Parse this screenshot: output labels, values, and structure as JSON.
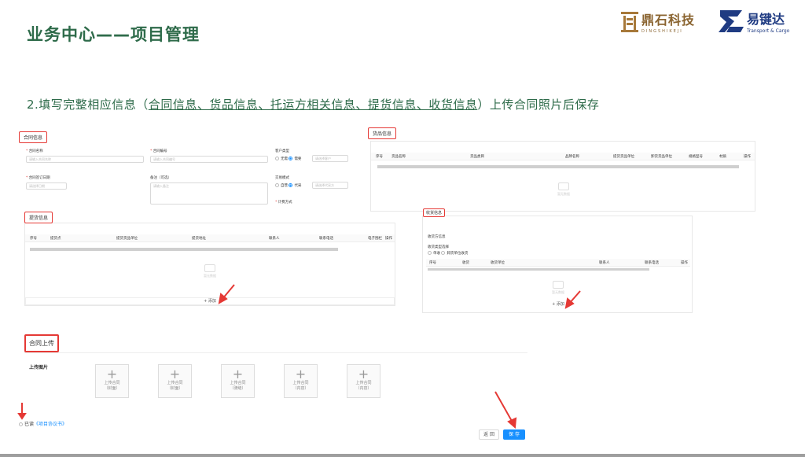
{
  "slide": {
    "title": "业务中心——项目管理",
    "subtitle_prefix": "2.填写完整相应信息（",
    "subtitle_underlined": "合同信息、货品信息、托运方相关信息、提货信息、收货信息",
    "subtitle_suffix": "）上传合同照片后保存"
  },
  "logos": {
    "dingshi_cn": "鼎石科技",
    "dingshi_en": "DINGSHIKEJI",
    "yijianda_cn": "易键达",
    "yijianda_en": "Transport & Cargo"
  },
  "contract_panel": {
    "tag": "合同信息",
    "name_label": "合同名称",
    "name_placeholder": "请输入合同名称",
    "number_label": "合同编号",
    "number_placeholder": "请输入合同编号",
    "customer_type_label": "客户类型",
    "customer_opt1": "无需",
    "customer_opt2": "需要",
    "customer_select": "请选择客户",
    "sign_date_label": "合同签订日期",
    "sign_date_placeholder": "请选择日期",
    "remark_label": "备注（可选）",
    "remark_placeholder": "请输入备注",
    "trade_mode_label": "交易模式",
    "trade_opt1": "自营",
    "trade_opt2": "代采",
    "trade_select": "请选择代采方",
    "billing_label": "计费方式"
  },
  "goods_panel": {
    "tag": "货品信息",
    "columns": [
      "序号",
      "货品名称",
      "货品类目",
      "品牌名称",
      "提货货品单位",
      "卸货货品单位",
      "规格型号",
      "材质",
      "操作"
    ],
    "empty_text": "暂无数据"
  },
  "pickup_panel": {
    "tag": "提货信息",
    "columns": [
      "序号",
      "提货点",
      "提货货品单位",
      "提货地址",
      "联系人",
      "联系电话",
      "电子围栏",
      "操作"
    ],
    "empty_text": "暂无数据",
    "add_label": "添加"
  },
  "receive_panel": {
    "tag": "收货信息",
    "section_label": "收货方信息",
    "sub_label": "收货类型选择",
    "opt1": "单收",
    "opt2": "卸货单位收货",
    "columns": [
      "序号",
      "收货",
      "收货单位",
      "联系人",
      "联系电话",
      "操作"
    ],
    "empty_text": "暂无数据",
    "add_label": "添加"
  },
  "upload_section": {
    "tag": "合同上传",
    "label": "上传图片",
    "slots": [
      {
        "line1": "上传合同",
        "line2": "（封面）"
      },
      {
        "line1": "上传合同",
        "line2": "（封面）"
      },
      {
        "line1": "上传合同",
        "line2": "（骑缝）"
      },
      {
        "line1": "上传合同",
        "line2": "（内容）"
      },
      {
        "line1": "上传合同",
        "line2": "（内容）"
      }
    ]
  },
  "agreement": {
    "prefix": "已读",
    "link": "《项目协议书》"
  },
  "buttons": {
    "back": "返 回",
    "save": "保 存"
  },
  "colors": {
    "title_green": "#2e6b4a",
    "highlight_red": "#e53935",
    "primary_blue": "#1890ff"
  }
}
